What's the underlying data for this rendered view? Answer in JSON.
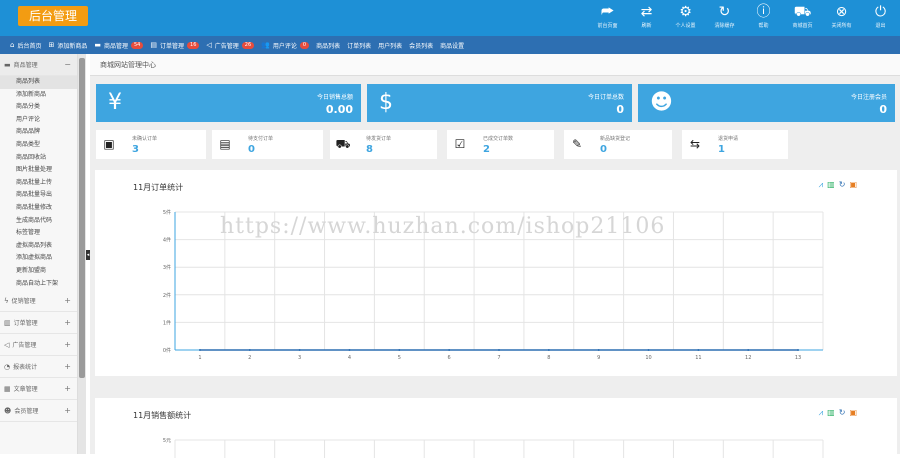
{
  "header": {
    "logo": "后台管理",
    "tools": [
      {
        "icon": "share-arrow-icon",
        "label": "前台页面"
      },
      {
        "icon": "refresh-icon",
        "label": "刷新"
      },
      {
        "icon": "gear-icon",
        "label": "个人设置"
      },
      {
        "icon": "clear-cache-icon",
        "label": "清除缓存"
      },
      {
        "icon": "help-icon",
        "label": "帮助"
      },
      {
        "icon": "cart-icon",
        "label": "商城首页"
      },
      {
        "icon": "close-circle-icon",
        "label": "关闭所有"
      },
      {
        "icon": "power-icon",
        "label": "退出"
      }
    ]
  },
  "navbar": [
    {
      "icon": "home-icon",
      "label": "后台首页",
      "badge": ""
    },
    {
      "icon": "add-icon",
      "label": "添加新商品",
      "badge": ""
    },
    {
      "icon": "folder-icon",
      "label": "商品管理",
      "badge": "54"
    },
    {
      "icon": "document-icon",
      "label": "订单管理",
      "badge": "16"
    },
    {
      "icon": "speaker-icon",
      "label": "广告管理",
      "badge": "26"
    },
    {
      "icon": "users-icon",
      "label": "用户评论",
      "badge": "0"
    },
    {
      "icon": "",
      "label": "商品列表",
      "badge": ""
    },
    {
      "icon": "",
      "label": "订单列表",
      "badge": ""
    },
    {
      "icon": "",
      "label": "用户列表",
      "badge": ""
    },
    {
      "icon": "",
      "label": "会员列表",
      "badge": ""
    },
    {
      "icon": "",
      "label": "商品设置",
      "badge": ""
    }
  ],
  "sidebar": {
    "active_group": {
      "icon": "folder-icon",
      "label": "商品管理",
      "toggle": "−"
    },
    "items": [
      "商品列表",
      "添加新商品",
      "商品分类",
      "用户评论",
      "商品品牌",
      "商品类型",
      "商品回收站",
      "图片批量处理",
      "商品批量上传",
      "商品批量导出",
      "商品批量修改",
      "生成商品代码",
      "标签管理",
      "虚拟商品列表",
      "添加虚拟商品",
      "更新加盟商",
      "商品自动上下架"
    ],
    "groups": [
      {
        "icon": "bolt-icon",
        "label": "促销管理",
        "toggle": "+"
      },
      {
        "icon": "orders-icon",
        "label": "订单管理",
        "toggle": "+"
      },
      {
        "icon": "speaker-icon",
        "label": "广告管理",
        "toggle": "+"
      },
      {
        "icon": "pie-icon",
        "label": "报表统计",
        "toggle": "+"
      },
      {
        "icon": "article-icon",
        "label": "文章管理",
        "toggle": "+"
      },
      {
        "icon": "members-icon",
        "label": "会员管理",
        "toggle": "+"
      }
    ]
  },
  "breadcrumb": "商城网站管理中心",
  "kpis": [
    {
      "icon": "yen-icon",
      "label": "今日销售总额",
      "value": "0.00"
    },
    {
      "icon": "money-chart-icon",
      "label": "今日订单总数",
      "value": "0"
    },
    {
      "icon": "user-card-icon",
      "label": "今日注册会员",
      "value": "0"
    }
  ],
  "stats": [
    {
      "icon": "box-icon",
      "label": "未确认订单",
      "value": "3"
    },
    {
      "icon": "clipboard-icon",
      "label": "待支付订单",
      "value": "0"
    },
    {
      "icon": "truck-icon",
      "label": "待发货订单",
      "value": "8"
    },
    {
      "icon": "check-icon",
      "label": "已成交订单数",
      "value": "2"
    },
    {
      "icon": "edit-icon",
      "label": "新品缺货登记",
      "value": "0"
    },
    {
      "icon": "return-icon",
      "label": "退货申请",
      "value": "1"
    }
  ],
  "panel_icons": [
    "line-chart-icon",
    "bar-chart-icon",
    "refresh-icon",
    "save-icon"
  ],
  "chart_data": [
    {
      "type": "line",
      "title": "11月订单统计",
      "x": [
        1,
        2,
        3,
        4,
        5,
        6,
        7,
        8,
        9,
        10,
        11,
        12,
        13
      ],
      "yticks": [
        "0件",
        "1件",
        "2件",
        "3件",
        "4件",
        "5件"
      ],
      "ylim": [
        0,
        5
      ],
      "series": [
        {
          "values": [
            0,
            0,
            0,
            0,
            0,
            0,
            0,
            0,
            0,
            0,
            0,
            0,
            0
          ]
        }
      ],
      "grid": true
    },
    {
      "type": "line",
      "title": "11月销售额统计",
      "yticks": [
        "5元"
      ],
      "grid": true
    }
  ],
  "watermark": "https://www.huzhan.com/ishop21106",
  "colors": {
    "header": "#1e90d6",
    "navbar": "#2d6fb2",
    "kpi": "#3ea5e0",
    "logo": "#f39c12",
    "badge": "#e74c3c"
  }
}
